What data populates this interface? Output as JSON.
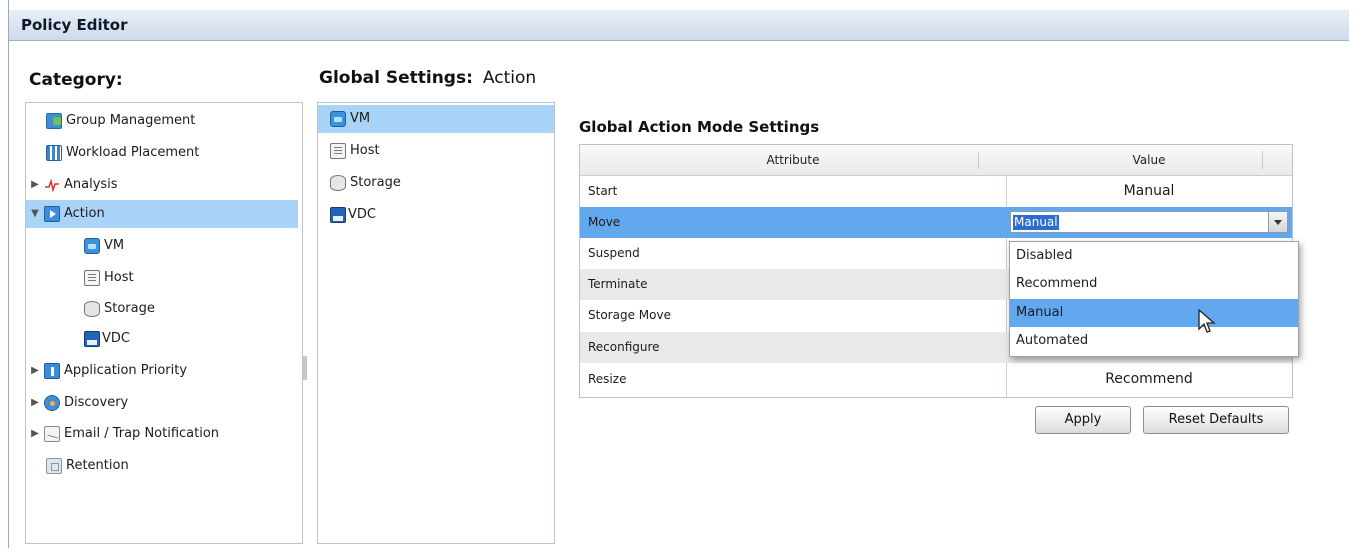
{
  "window": {
    "title": "Policy Editor"
  },
  "category": {
    "label": "Category:",
    "items": [
      {
        "label": "Group Management",
        "icon": "group-management-icon"
      },
      {
        "label": "Workload Placement",
        "icon": "workload-placement-icon"
      },
      {
        "label": "Analysis",
        "icon": "analysis-icon"
      },
      {
        "label": "Action",
        "icon": "action-icon"
      },
      {
        "label": "VM",
        "icon": "vm-icon"
      },
      {
        "label": "Host",
        "icon": "host-icon"
      },
      {
        "label": "Storage",
        "icon": "storage-icon"
      },
      {
        "label": "VDC",
        "icon": "vdc-icon"
      },
      {
        "label": "Application Priority",
        "icon": "application-priority-icon"
      },
      {
        "label": "Discovery",
        "icon": "discovery-icon"
      },
      {
        "label": "Email / Trap Notification",
        "icon": "email-icon"
      },
      {
        "label": "Retention",
        "icon": "retention-icon"
      }
    ]
  },
  "global": {
    "label": "Global Settings:",
    "sub": "Action",
    "items": [
      {
        "label": "VM",
        "icon": "vm-icon"
      },
      {
        "label": "Host",
        "icon": "host-icon"
      },
      {
        "label": "Storage",
        "icon": "storage-icon"
      },
      {
        "label": "VDC",
        "icon": "vdc-icon"
      }
    ]
  },
  "settings": {
    "title": "Global Action Mode Settings",
    "columns": [
      "Attribute",
      "Value"
    ],
    "rows": [
      {
        "attr": "Start",
        "value": "Manual"
      },
      {
        "attr": "Move",
        "value": "Manual"
      },
      {
        "attr": "Suspend",
        "value": ""
      },
      {
        "attr": "Terminate",
        "value": ""
      },
      {
        "attr": "Storage Move",
        "value": ""
      },
      {
        "attr": "Reconfigure",
        "value": ""
      },
      {
        "attr": "Resize",
        "value": "Recommend"
      }
    ],
    "dropdown_options": [
      "Disabled",
      "Recommend",
      "Manual",
      "Automated"
    ],
    "selected_option": "Manual"
  },
  "buttons": {
    "apply": "Apply",
    "reset": "Reset Defaults"
  },
  "colors": {
    "selection": "#a9d4f7",
    "row_highlight": "#62a8ee",
    "header": "#cfdbea"
  }
}
